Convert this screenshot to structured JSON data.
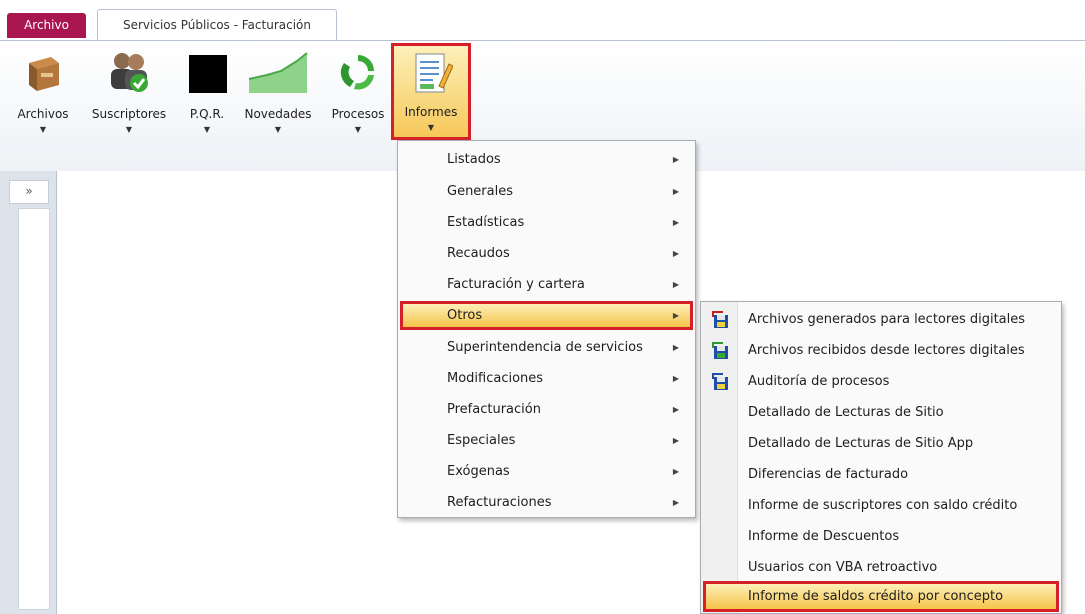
{
  "tabs": {
    "archivo": "Archivo",
    "main": "Servicios Públicos - Facturación"
  },
  "ribbon": {
    "buttons": [
      {
        "label": "Archivos",
        "icon": "box-icon",
        "has_dropdown": true
      },
      {
        "label": "Suscriptores",
        "icon": "users-check-icon",
        "has_dropdown": true
      },
      {
        "label": "P.Q.R.",
        "icon": "redacted-icon",
        "has_dropdown": true
      },
      {
        "label": "Novedades",
        "icon": "green-chart-icon",
        "has_dropdown": true
      },
      {
        "label": "Procesos",
        "icon": "recycle-icon",
        "has_dropdown": true
      },
      {
        "label": "Informes",
        "icon": "report-pencil-icon",
        "has_dropdown": true
      }
    ]
  },
  "nav": {
    "expand_label": "»"
  },
  "menu": {
    "items": [
      {
        "label": "Listados",
        "submenu": true
      },
      {
        "label": "Generales",
        "submenu": true
      },
      {
        "label": "Estadísticas",
        "submenu": true
      },
      {
        "label": "Recaudos",
        "submenu": true
      },
      {
        "label": "Facturación y cartera",
        "submenu": true
      },
      {
        "label": "Otros",
        "submenu": true,
        "highlighted": true
      },
      {
        "label": "Superintendencia de servicios",
        "submenu": true
      },
      {
        "label": "Modificaciones",
        "submenu": true
      },
      {
        "label": "Prefacturación",
        "submenu": true
      },
      {
        "label": "Especiales",
        "submenu": true
      },
      {
        "label": "Exógenas",
        "submenu": true
      },
      {
        "label": "Refacturaciones",
        "submenu": true
      }
    ],
    "chevron": "▶"
  },
  "submenu": {
    "items": [
      {
        "label": "Archivos generados para lectores digitales",
        "icon": "floppy-transfer-icon"
      },
      {
        "label": "Archivos recibidos desde lectores digitales",
        "icon": "floppy-transfer-icon"
      },
      {
        "label": "Auditoría de procesos",
        "icon": "floppy-transfer-icon"
      },
      {
        "label": "Detallado de Lecturas de Sitio"
      },
      {
        "label": "Detallado de Lecturas de Sitio App"
      },
      {
        "label": "Diferencias de facturado"
      },
      {
        "label": "Informe de suscriptores con saldo crédito"
      },
      {
        "label": "Informe de Descuentos"
      },
      {
        "label": "Usuarios con VBA retroactivo"
      },
      {
        "label": "Informe de saldos crédito por concepto",
        "highlighted": true
      }
    ]
  },
  "colors": {
    "archivo_tab": "#a8154f",
    "highlight_border": "#d62029",
    "highlight_fill": "#f6c349"
  }
}
